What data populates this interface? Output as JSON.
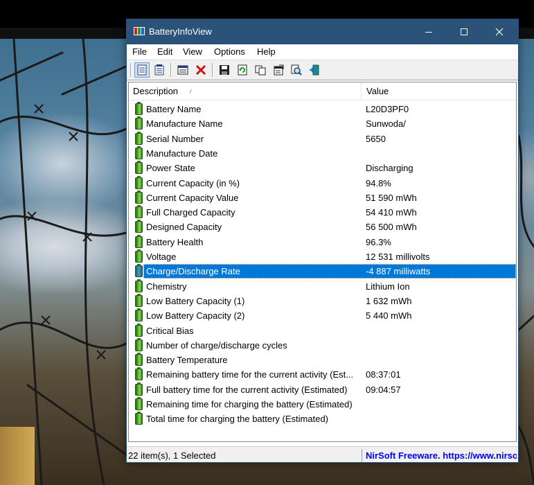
{
  "window": {
    "title": "BatteryInfoView",
    "accent_color": "#2b5279",
    "controls": [
      "minimize-icon",
      "maximize-icon",
      "close-icon"
    ]
  },
  "menu": [
    "File",
    "Edit",
    "View",
    "Options",
    "Help"
  ],
  "toolbar": {
    "buttons": [
      "battery-info-view-icon",
      "battery-log-view-icon",
      "html-report-icon",
      "delete-icon",
      "save-icon",
      "refresh-icon",
      "copy-icon",
      "properties-icon",
      "find-icon",
      "exit-icon"
    ]
  },
  "list": {
    "columns": {
      "description": "Description",
      "value": "Value",
      "sort_indicator": "/"
    },
    "selected_color": "#0078d7",
    "rows": [
      {
        "description": "Battery Name",
        "value": "L20D3PF0"
      },
      {
        "description": "Manufacture Name",
        "value": "Sunwoda/"
      },
      {
        "description": "Serial Number",
        "value": "5650"
      },
      {
        "description": "Manufacture Date",
        "value": ""
      },
      {
        "description": "Power State",
        "value": "Discharging"
      },
      {
        "description": "Current Capacity (in %)",
        "value": "94.8%"
      },
      {
        "description": "Current Capacity Value",
        "value": "51 590 mWh"
      },
      {
        "description": "Full Charged Capacity",
        "value": "54 410 mWh"
      },
      {
        "description": "Designed Capacity",
        "value": "56 500 mWh"
      },
      {
        "description": "Battery Health",
        "value": "96.3%"
      },
      {
        "description": "Voltage",
        "value": "12 531 millivolts"
      },
      {
        "description": "Charge/Discharge Rate",
        "value": "-4 887 milliwatts",
        "selected": true
      },
      {
        "description": "Chemistry",
        "value": "Lithium Ion"
      },
      {
        "description": "Low Battery Capacity (1)",
        "value": "1 632 mWh"
      },
      {
        "description": "Low Battery Capacity (2)",
        "value": "5 440 mWh"
      },
      {
        "description": "Critical Bias",
        "value": ""
      },
      {
        "description": "Number of charge/discharge cycles",
        "value": ""
      },
      {
        "description": "Battery Temperature",
        "value": ""
      },
      {
        "description": "Remaining battery time for the current activity (Est...",
        "value": "08:37:01"
      },
      {
        "description": "Full battery time for the current activity (Estimated)",
        "value": "09:04:57"
      },
      {
        "description": "Remaining time for charging the battery (Estimated)",
        "value": ""
      },
      {
        "description": "Total  time for charging the battery (Estimated)",
        "value": ""
      }
    ]
  },
  "status": {
    "items": "22 item(s), 1 Selected",
    "link": "NirSoft Freeware. https://www.nirsoft.net"
  }
}
